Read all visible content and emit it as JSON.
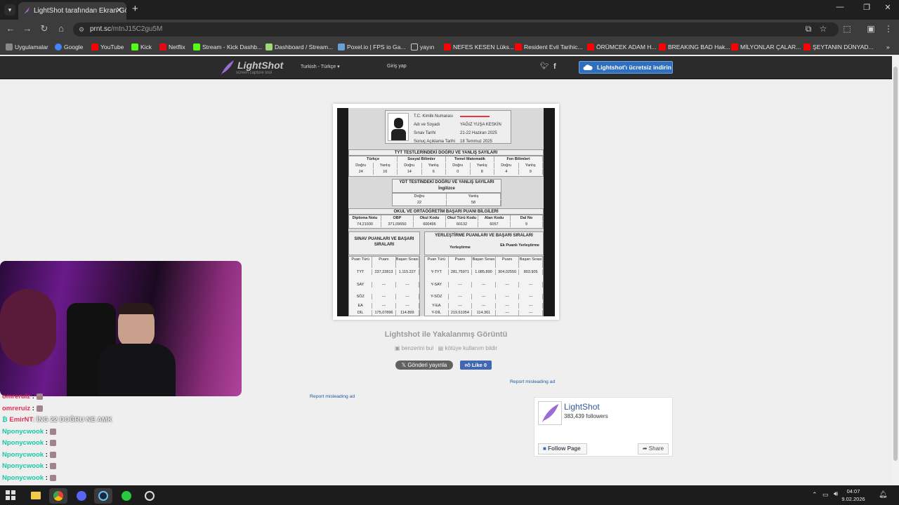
{
  "browser": {
    "tab_title": "LightShot tarafından Ekran Görü",
    "url_host": "prnt.sc",
    "url_path": "/mtnJ15C2gu5M",
    "bookmarks": [
      {
        "label": "Uygulamalar",
        "color": "#888888"
      },
      {
        "label": "Google",
        "color": "#4285f4"
      },
      {
        "label": "YouTube",
        "color": "#ff0000"
      },
      {
        "label": "Kick",
        "color": "#53fc18"
      },
      {
        "label": "Netflix",
        "color": "#e50914"
      },
      {
        "label": "Stream - Kick Dashb...",
        "color": "#53fc18"
      },
      {
        "label": "Dashboard / Stream...",
        "color": "#9fd67a"
      },
      {
        "label": "Poxel.io | FPS io Ga...",
        "color": "#6aa0d8"
      },
      {
        "label": "yayın",
        "color": "#cccccc"
      },
      {
        "label": "NEFES KESEN Lüks...",
        "color": "#ff0000"
      },
      {
        "label": "Resident Evil Tarihic...",
        "color": "#ff0000"
      },
      {
        "label": "ÖRÜMCEK ADAM H...",
        "color": "#ff0000"
      },
      {
        "label": "BREAKING BAD Hak...",
        "color": "#ff0000"
      },
      {
        "label": "MİLYONLAR ÇALAR...",
        "color": "#ff0000"
      },
      {
        "label": "ŞEYTANIN DÜNYAD...",
        "color": "#ff0000"
      }
    ]
  },
  "lightshot": {
    "logo_name": "LightShot",
    "logo_tagline": "screen capture tool",
    "language": "Turkish - Türkçe",
    "login": "Giriş yap",
    "download_button": "Lightshot'ı ücretsiz indirin",
    "caption": "Lightshot ile Yakalanmış Görüntü",
    "similar": "benzerini bul",
    "report": "kötüye kullanım bildir",
    "tweet": "Gönderi yayınla",
    "like": "Like 0",
    "misleading_ad": "Report misleading ad",
    "fb": {
      "name": "LightShot",
      "followers": "383,439 followers",
      "follow": "Follow Page",
      "share": "Share"
    }
  },
  "screenshot": {
    "id_label": "T.C. Kimlik Numarası",
    "name_label": "Adı ve Soyadı",
    "name_value": "YAĞIZ YUŞA KESKİN",
    "exam_date_label": "Sınav Tarihi",
    "exam_date_value": "21-22 Haziran 2025",
    "result_date_label": "Sonuç Açıklama Tarihi",
    "result_date_value": "18 Temmuz 2025",
    "tyt_title": "TYT TESTLERİNDEKİ DOĞRU VE YANLIŞ SAYILARI",
    "tyt_subjects": [
      "Türkçe",
      "Sosyal Bilimler",
      "Temel Matematik",
      "Fen Bilimleri"
    ],
    "dy": [
      "Doğru",
      "Yanlış",
      "Doğru",
      "Yanlış",
      "Doğru",
      "Yanlış",
      "Doğru",
      "Yanlış"
    ],
    "tyt_values": [
      "24",
      "16",
      "14",
      "6",
      "0",
      "8",
      "4",
      "9"
    ],
    "ydt_title": "YDT TESTİNDEKİ DOĞRU VE YANLIŞ SAYILARI",
    "ydt_lang": "İngilizce",
    "ydt_dy": [
      "Doğru",
      "Yanlış"
    ],
    "ydt_values": [
      "22",
      "58"
    ],
    "school_title": "OKUL VE ORTAÖĞRETİM BAŞARI PUANI BİLGİLERİ",
    "school_headers": [
      "Diploma Notu",
      "OBP",
      "Okul Kodu",
      "Okul Türü Kodu",
      "Alan Kodu",
      "Dal No"
    ],
    "school_values": [
      "74,21930",
      "371,09650",
      "600496",
      "60132",
      "6057",
      "9"
    ],
    "sinav_title": "SINAV PUANLARI VE BAŞARI SIRALARI",
    "yerlestirme_title": "YERLEŞTİRME PUANLARI VE BAŞARI SIRALARI",
    "yerlestirme": "Yerleştirme",
    "ek_puanli": "Ek Puanlı Yerleştirme",
    "score_headers_left": [
      "Puan Türü",
      "Puanı",
      "Başarı Sırası"
    ],
    "score_headers_right": [
      "Puan Türü",
      "Puanı",
      "Başarı Sırası",
      "Puanı",
      "Başarı Sırası"
    ],
    "score_rows": [
      [
        "TYT",
        "237,22813",
        "1.115.227",
        "Y-TYT",
        "281,75971",
        "1.085.890",
        "304,02550",
        "803.905"
      ],
      [
        "SAY",
        "---",
        "---",
        "Y-SAY",
        "---",
        "---",
        "---",
        "---"
      ],
      [
        "SÖZ",
        "---",
        "---",
        "Y-SÖZ",
        "---",
        "---",
        "---",
        "---"
      ],
      [
        "EA",
        "---",
        "---",
        "Y-EA",
        "---",
        "---",
        "---",
        "---"
      ],
      [
        "DİL",
        "175,07896",
        "114.899",
        "Y-DİL",
        "219,61054",
        "114.361",
        "---",
        "---"
      ]
    ]
  },
  "chat": [
    {
      "user": "omreruiz",
      "msg": "",
      "color": "#e0315a"
    },
    {
      "user": "omreruiz",
      "msg": "",
      "color": "#e0315a"
    },
    {
      "user": "EmirNT",
      "msg": ": İNG 22 DOĞRU NE AMK",
      "color": "#e0315a"
    },
    {
      "user": "Nponycwook",
      "msg": "",
      "color": "#18c8a8"
    },
    {
      "user": "Nponycwook",
      "msg": "",
      "color": "#18c8a8"
    },
    {
      "user": "Nponycwook",
      "msg": "",
      "color": "#18c8a8"
    },
    {
      "user": "Nponycwook",
      "msg": "",
      "color": "#18c8a8"
    },
    {
      "user": "Nponycwook",
      "msg": "",
      "color": "#18c8a8"
    }
  ],
  "taskbar": {
    "time": "04:07",
    "date": "9.02.2026"
  }
}
